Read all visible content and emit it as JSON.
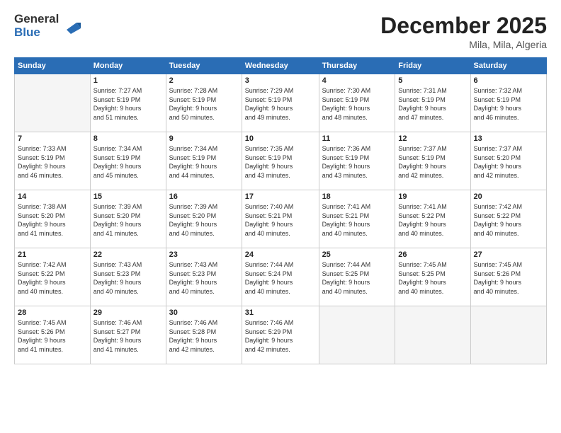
{
  "logo": {
    "line1": "General",
    "line2": "Blue"
  },
  "title": "December 2025",
  "subtitle": "Mila, Mila, Algeria",
  "weekdays": [
    "Sunday",
    "Monday",
    "Tuesday",
    "Wednesday",
    "Thursday",
    "Friday",
    "Saturday"
  ],
  "weeks": [
    [
      {
        "day": "",
        "info": ""
      },
      {
        "day": "1",
        "info": "Sunrise: 7:27 AM\nSunset: 5:19 PM\nDaylight: 9 hours\nand 51 minutes."
      },
      {
        "day": "2",
        "info": "Sunrise: 7:28 AM\nSunset: 5:19 PM\nDaylight: 9 hours\nand 50 minutes."
      },
      {
        "day": "3",
        "info": "Sunrise: 7:29 AM\nSunset: 5:19 PM\nDaylight: 9 hours\nand 49 minutes."
      },
      {
        "day": "4",
        "info": "Sunrise: 7:30 AM\nSunset: 5:19 PM\nDaylight: 9 hours\nand 48 minutes."
      },
      {
        "day": "5",
        "info": "Sunrise: 7:31 AM\nSunset: 5:19 PM\nDaylight: 9 hours\nand 47 minutes."
      },
      {
        "day": "6",
        "info": "Sunrise: 7:32 AM\nSunset: 5:19 PM\nDaylight: 9 hours\nand 46 minutes."
      }
    ],
    [
      {
        "day": "7",
        "info": "Sunrise: 7:33 AM\nSunset: 5:19 PM\nDaylight: 9 hours\nand 46 minutes."
      },
      {
        "day": "8",
        "info": "Sunrise: 7:34 AM\nSunset: 5:19 PM\nDaylight: 9 hours\nand 45 minutes."
      },
      {
        "day": "9",
        "info": "Sunrise: 7:34 AM\nSunset: 5:19 PM\nDaylight: 9 hours\nand 44 minutes."
      },
      {
        "day": "10",
        "info": "Sunrise: 7:35 AM\nSunset: 5:19 PM\nDaylight: 9 hours\nand 43 minutes."
      },
      {
        "day": "11",
        "info": "Sunrise: 7:36 AM\nSunset: 5:19 PM\nDaylight: 9 hours\nand 43 minutes."
      },
      {
        "day": "12",
        "info": "Sunrise: 7:37 AM\nSunset: 5:19 PM\nDaylight: 9 hours\nand 42 minutes."
      },
      {
        "day": "13",
        "info": "Sunrise: 7:37 AM\nSunset: 5:20 PM\nDaylight: 9 hours\nand 42 minutes."
      }
    ],
    [
      {
        "day": "14",
        "info": "Sunrise: 7:38 AM\nSunset: 5:20 PM\nDaylight: 9 hours\nand 41 minutes."
      },
      {
        "day": "15",
        "info": "Sunrise: 7:39 AM\nSunset: 5:20 PM\nDaylight: 9 hours\nand 41 minutes."
      },
      {
        "day": "16",
        "info": "Sunrise: 7:39 AM\nSunset: 5:20 PM\nDaylight: 9 hours\nand 40 minutes."
      },
      {
        "day": "17",
        "info": "Sunrise: 7:40 AM\nSunset: 5:21 PM\nDaylight: 9 hours\nand 40 minutes."
      },
      {
        "day": "18",
        "info": "Sunrise: 7:41 AM\nSunset: 5:21 PM\nDaylight: 9 hours\nand 40 minutes."
      },
      {
        "day": "19",
        "info": "Sunrise: 7:41 AM\nSunset: 5:22 PM\nDaylight: 9 hours\nand 40 minutes."
      },
      {
        "day": "20",
        "info": "Sunrise: 7:42 AM\nSunset: 5:22 PM\nDaylight: 9 hours\nand 40 minutes."
      }
    ],
    [
      {
        "day": "21",
        "info": "Sunrise: 7:42 AM\nSunset: 5:22 PM\nDaylight: 9 hours\nand 40 minutes."
      },
      {
        "day": "22",
        "info": "Sunrise: 7:43 AM\nSunset: 5:23 PM\nDaylight: 9 hours\nand 40 minutes."
      },
      {
        "day": "23",
        "info": "Sunrise: 7:43 AM\nSunset: 5:23 PM\nDaylight: 9 hours\nand 40 minutes."
      },
      {
        "day": "24",
        "info": "Sunrise: 7:44 AM\nSunset: 5:24 PM\nDaylight: 9 hours\nand 40 minutes."
      },
      {
        "day": "25",
        "info": "Sunrise: 7:44 AM\nSunset: 5:25 PM\nDaylight: 9 hours\nand 40 minutes."
      },
      {
        "day": "26",
        "info": "Sunrise: 7:45 AM\nSunset: 5:25 PM\nDaylight: 9 hours\nand 40 minutes."
      },
      {
        "day": "27",
        "info": "Sunrise: 7:45 AM\nSunset: 5:26 PM\nDaylight: 9 hours\nand 40 minutes."
      }
    ],
    [
      {
        "day": "28",
        "info": "Sunrise: 7:45 AM\nSunset: 5:26 PM\nDaylight: 9 hours\nand 41 minutes."
      },
      {
        "day": "29",
        "info": "Sunrise: 7:46 AM\nSunset: 5:27 PM\nDaylight: 9 hours\nand 41 minutes."
      },
      {
        "day": "30",
        "info": "Sunrise: 7:46 AM\nSunset: 5:28 PM\nDaylight: 9 hours\nand 42 minutes."
      },
      {
        "day": "31",
        "info": "Sunrise: 7:46 AM\nSunset: 5:29 PM\nDaylight: 9 hours\nand 42 minutes."
      },
      {
        "day": "",
        "info": ""
      },
      {
        "day": "",
        "info": ""
      },
      {
        "day": "",
        "info": ""
      }
    ]
  ]
}
